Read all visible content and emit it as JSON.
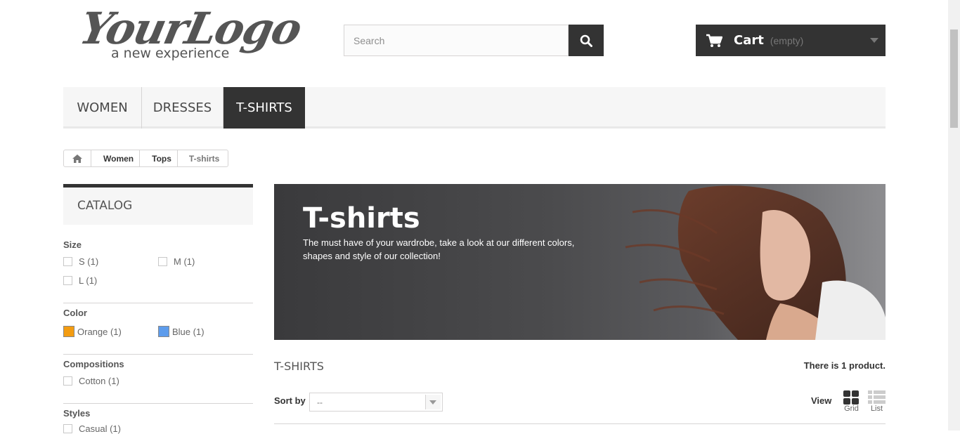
{
  "logo": {
    "script_text": "YourLogo",
    "tagline": "a new experience"
  },
  "search": {
    "placeholder": "Search",
    "icon": "search-icon"
  },
  "cart": {
    "label": "Cart",
    "quantity": "(empty)",
    "icon": "cart-icon"
  },
  "nav": {
    "items": [
      {
        "label": "WOMEN"
      },
      {
        "label": "DRESSES"
      },
      {
        "label": "T-SHIRTS",
        "active": true
      }
    ]
  },
  "breadcrumb": {
    "home_icon": "home-icon",
    "items": [
      "Women",
      "Tops",
      "T-shirts"
    ]
  },
  "sidebar": {
    "catalog_title": "CATALOG",
    "size": {
      "title": "Size",
      "options": [
        "S (1)",
        "M (1)",
        "L (1)"
      ]
    },
    "color": {
      "title": "Color",
      "options": [
        {
          "label": "Orange (1)",
          "color": "#f39c11"
        },
        {
          "label": "Blue (1)",
          "color": "#5d9cec"
        }
      ]
    },
    "compositions": {
      "title": "Compositions",
      "options": [
        "Cotton (1)"
      ]
    },
    "styles": {
      "title": "Styles",
      "options": [
        "Casual (1)"
      ]
    }
  },
  "banner": {
    "title": "T-shirts",
    "text": "The must have of your wardrobe, take a look at our different colors, shapes and style of our collection!"
  },
  "products": {
    "category_name": "T-SHIRTS",
    "count_prefix": "There is ",
    "count_value": "1",
    "count_suffix": " product.",
    "sort_label": "Sort by",
    "sort_value": "--",
    "view_label": "View",
    "view_grid": "Grid",
    "view_list": "List"
  },
  "colors": {
    "dark": "#333333",
    "border": "#d6d4d4",
    "light_bg": "#f6f6f6"
  }
}
